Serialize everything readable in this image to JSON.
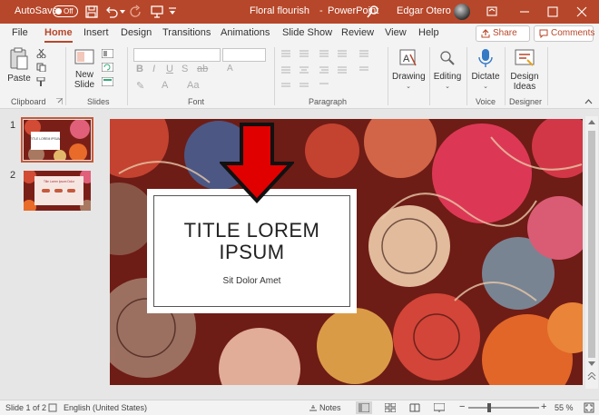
{
  "titlebar": {
    "autosave_label": "AutoSave",
    "autosave_state": "Off",
    "document_title": "Floral flourish",
    "separator": "-",
    "app_name": "PowerPoint",
    "user_name": "Edgar Otero"
  },
  "tabs": [
    "File",
    "Home",
    "Insert",
    "Design",
    "Transitions",
    "Animations",
    "Slide Show",
    "Review",
    "View",
    "Help"
  ],
  "active_tab": "Home",
  "actions": {
    "share": "Share",
    "comments": "Comments"
  },
  "ribbon": {
    "paste": "Paste",
    "new_slide_1": "New",
    "new_slide_2": "Slide",
    "drawing": "Drawing",
    "editing": "Editing",
    "dictate": "Dictate",
    "design_ideas_1": "Design",
    "design_ideas_2": "Ideas",
    "groups": {
      "clipboard": "Clipboard",
      "slides": "Slides",
      "font": "Font",
      "paragraph": "Paragraph",
      "voice": "Voice",
      "designer": "Designer"
    }
  },
  "slides": [
    {
      "number": "1",
      "thumb_title": "TITLE LOREM IPSUM"
    },
    {
      "number": "2",
      "thumb_title": "Title Lorem Ipsum Dolor"
    }
  ],
  "slide": {
    "title_line1": "TITLE LOREM",
    "title_line2": "IPSUM",
    "subtitle": "Sit Dolor Amet"
  },
  "status": {
    "slide_info": "Slide 1 of 2",
    "language": "English (United States)",
    "notes": "Notes",
    "zoom": "55 %"
  },
  "colors": {
    "accent": "#b7472a",
    "arrow": "#e00000"
  }
}
